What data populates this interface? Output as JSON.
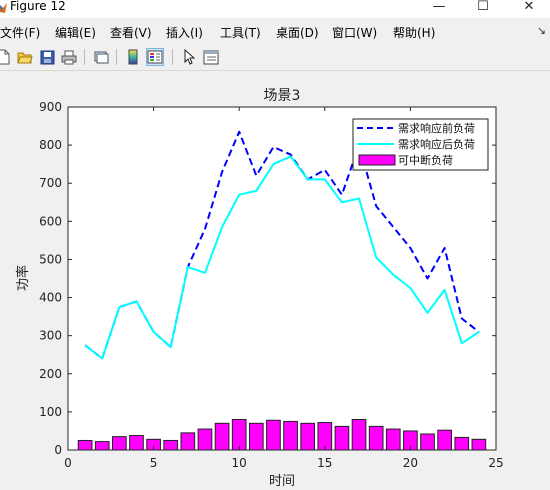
{
  "window": {
    "title": "Figure 12",
    "minimize": "—",
    "maximize": "☐",
    "close": "✕"
  },
  "menu": [
    {
      "label": "文件(F)"
    },
    {
      "label": "编辑(E)"
    },
    {
      "label": "查看(V)"
    },
    {
      "label": "插入(I)"
    },
    {
      "label": "工具(T)"
    },
    {
      "label": "桌面(D)"
    },
    {
      "label": "窗口(W)"
    },
    {
      "label": "帮助(H)"
    }
  ],
  "toolbar": [
    {
      "icon": "new-figure-icon"
    },
    {
      "icon": "open-file-icon"
    },
    {
      "icon": "save-icon"
    },
    {
      "icon": "print-icon"
    },
    {
      "icon": "link-plot-icon"
    },
    {
      "icon": "colorbar-icon"
    },
    {
      "icon": "legend-icon"
    },
    {
      "icon": "edit-plot-icon"
    },
    {
      "icon": "property-inspector-icon"
    }
  ],
  "chart_data": {
    "type": "line",
    "title": "场景3",
    "xlabel": "时间",
    "ylabel": "功率",
    "xlim": [
      0,
      25
    ],
    "ylim": [
      0,
      900
    ],
    "xticks": [
      0,
      5,
      10,
      15,
      20,
      25
    ],
    "yticks": [
      0,
      100,
      200,
      300,
      400,
      500,
      600,
      700,
      800,
      900
    ],
    "grid": false,
    "legend_position": "top-right",
    "x": [
      1,
      2,
      3,
      4,
      5,
      6,
      7,
      8,
      9,
      10,
      11,
      12,
      13,
      14,
      15,
      16,
      17,
      18,
      19,
      20,
      21,
      22,
      23,
      24
    ],
    "series": [
      {
        "name": "需求响应前负荷",
        "type": "line",
        "style": "dashed",
        "color": "#0000ff",
        "values": [
          275,
          240,
          375,
          390,
          310,
          270,
          480,
          580,
          730,
          835,
          720,
          795,
          775,
          710,
          735,
          670,
          800,
          640,
          585,
          530,
          450,
          530,
          345,
          310
        ]
      },
      {
        "name": "需求响应后负荷",
        "type": "line",
        "style": "solid",
        "color": "#00ffff",
        "values": [
          275,
          240,
          375,
          390,
          310,
          270,
          480,
          465,
          585,
          670,
          680,
          750,
          770,
          710,
          710,
          650,
          660,
          505,
          460,
          425,
          360,
          420,
          280,
          310
        ]
      },
      {
        "name": "可中断负荷",
        "type": "bar",
        "color": "#ff00ff",
        "values": [
          25,
          22,
          35,
          38,
          28,
          25,
          45,
          55,
          70,
          80,
          70,
          78,
          75,
          70,
          72,
          62,
          80,
          62,
          55,
          50,
          42,
          52,
          33,
          28
        ]
      }
    ]
  }
}
